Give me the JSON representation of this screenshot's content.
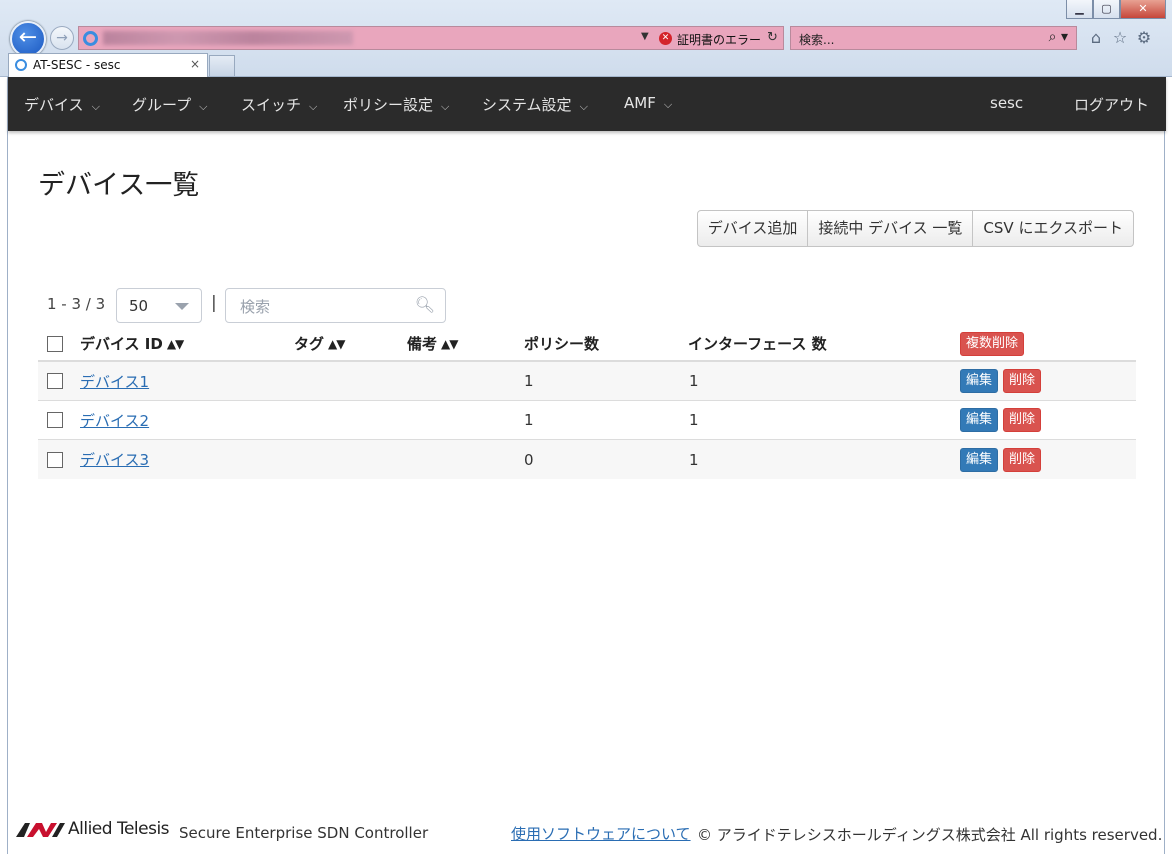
{
  "browser": {
    "address_status": "証明書のエラー",
    "search_placeholder": "検索...",
    "tab_title": "AT-SESC - sesc",
    "tab_close": "×"
  },
  "navbar": {
    "items": [
      {
        "label": "デバイス"
      },
      {
        "label": "グループ"
      },
      {
        "label": "スイッチ"
      },
      {
        "label": "ポリシー設定"
      },
      {
        "label": "システム設定"
      },
      {
        "label": "AMF"
      }
    ],
    "user": "sesc",
    "logout": "ログアウト"
  },
  "page": {
    "title": "デバイス一覧",
    "actions": {
      "add": "デバイス追加",
      "connected": "接続中 デバイス 一覧",
      "export": "CSV にエクスポート"
    }
  },
  "toolbar": {
    "range": "1 - 3 / 3",
    "per_page": "50",
    "separator": "|",
    "search_placeholder": "検索"
  },
  "table": {
    "headers": {
      "device_id": "デバイス ID",
      "tag": "タグ",
      "note": "備考",
      "policy_count": "ポリシー数",
      "interface_count": "インターフェース 数",
      "bulk_delete": "複数削除"
    },
    "rows": [
      {
        "device_id": "デバイス1",
        "tag": "",
        "note": "",
        "policy_count": "1",
        "interface_count": "1"
      },
      {
        "device_id": "デバイス2",
        "tag": "",
        "note": "",
        "policy_count": "1",
        "interface_count": "1"
      },
      {
        "device_id": "デバイス3",
        "tag": "",
        "note": "",
        "policy_count": "0",
        "interface_count": "1"
      }
    ],
    "edit_label": "編集",
    "delete_label": "削除"
  },
  "footer": {
    "logo": "Allied Telesis",
    "product": "Secure Enterprise SDN Controller",
    "software_link": "使用ソフトウェアについて",
    "copyright": "© アライドテレシスホールディングス株式会社 All rights reserved."
  },
  "colors": {
    "navbar_bg": "#2b2b2b",
    "link": "#2a6db3",
    "edit_button": "#337ab7",
    "delete_button": "#d9534f",
    "address_bar_error": "#e9a6bd"
  }
}
